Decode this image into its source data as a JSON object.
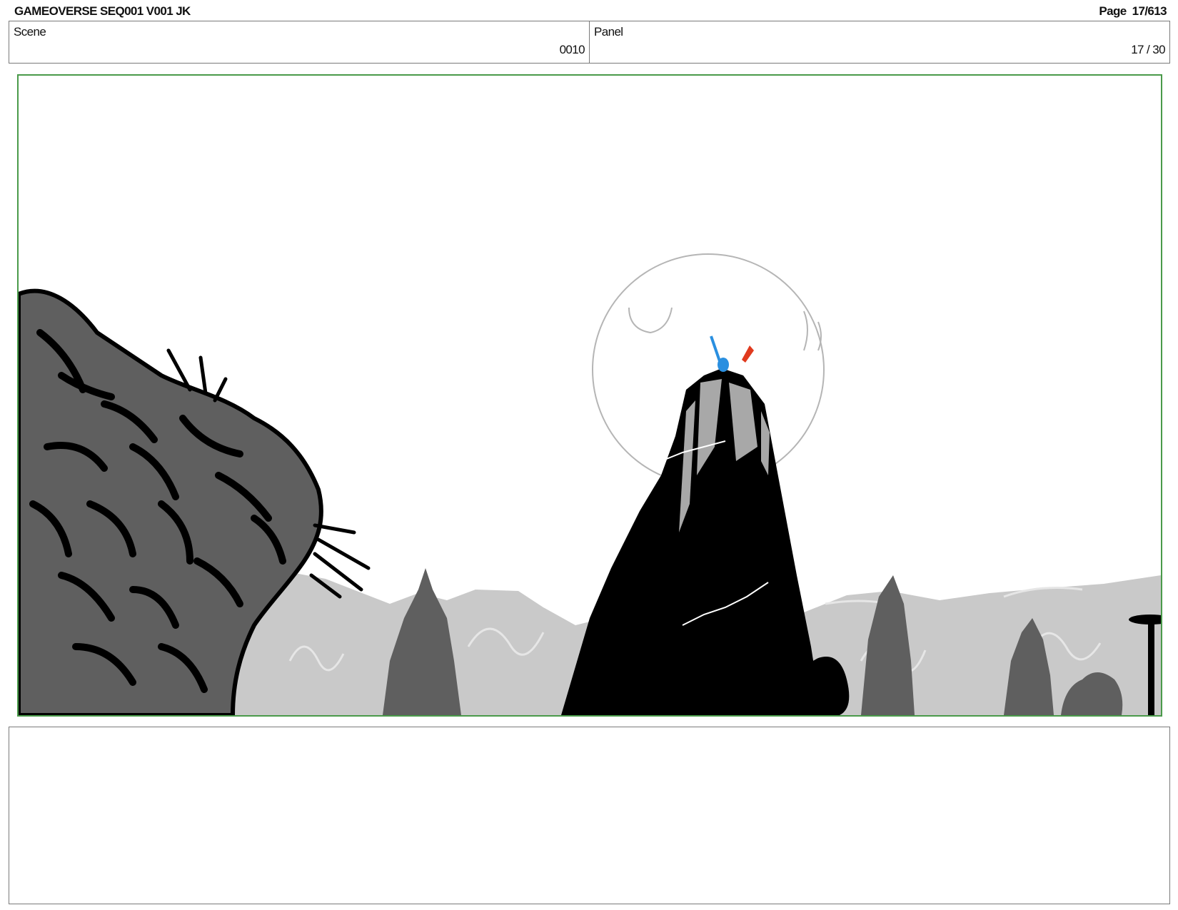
{
  "header": {
    "title": "GAMEOVERSE SEQ001 V001 JK",
    "page_word": "Page",
    "page_number": "17/613"
  },
  "info": {
    "scene_label": "Scene",
    "scene_value": "0010",
    "panel_label": "Panel",
    "panel_value": "17 / 30"
  },
  "artwork": {
    "frame_color": "#4a9a4a",
    "moon_outline_color": "#b5b5b5",
    "rock_color": "#000000",
    "foliage_color": "#5f5f5f",
    "background_mountain_color": "#c9c9c9",
    "accent_blue": "#2a8fe0",
    "accent_red": "#e03a1e"
  },
  "notes": {
    "text": ""
  }
}
